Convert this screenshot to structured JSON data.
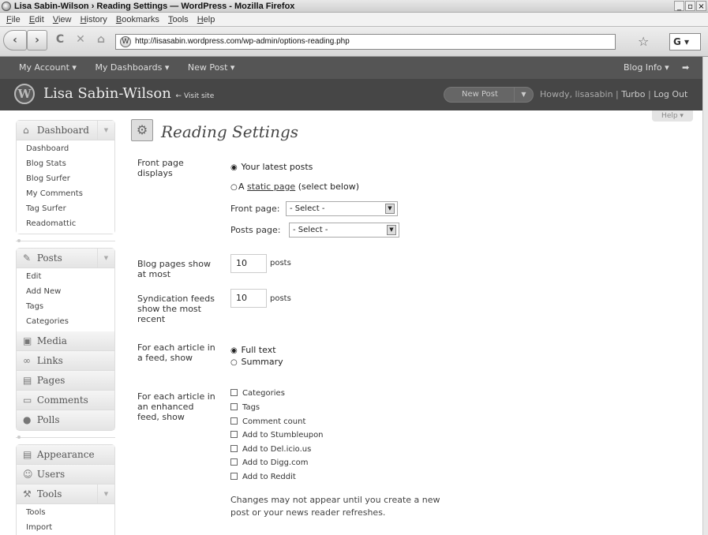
{
  "window": {
    "title": "Lisa Sabin-Wilson › Reading Settings — WordPress - Mozilla Firefox",
    "controls": [
      "_",
      "▫",
      "×"
    ]
  },
  "menubar": [
    "File",
    "Edit",
    "View",
    "History",
    "Bookmarks",
    "Tools",
    "Help"
  ],
  "nav": {
    "back": "‹",
    "forward": "›",
    "reload": "C",
    "stop": "✕",
    "home": "⌂",
    "url": "http://lisasabin.wordpress.com/wp-admin/options-reading.php",
    "favicon": "W",
    "search_engine": "G"
  },
  "adminbar": {
    "left": [
      "My Account ▾",
      "My Dashboards ▾",
      "New Post ▾"
    ],
    "right": "Blog Info ▾",
    "arrow": "➡"
  },
  "header": {
    "site_title": "Lisa Sabin-Wilson",
    "visit_site": "← Visit site",
    "new_post": "New Post",
    "howdy": "Howdy, lisasabin",
    "turbo": "Turbo",
    "logout": "Log Out"
  },
  "help": "Help ▾",
  "sidebar": {
    "dashboard": {
      "label": "Dashboard",
      "items": [
        "Dashboard",
        "Blog Stats",
        "Blog Surfer",
        "My Comments",
        "Tag Surfer",
        "Readomattic"
      ]
    },
    "posts": {
      "label": "Posts",
      "items": [
        "Edit",
        "Add New",
        "Tags",
        "Categories"
      ]
    },
    "menus": [
      "Media",
      "Links",
      "Pages",
      "Comments",
      "Polls"
    ],
    "menus2": [
      "Appearance",
      "Users"
    ],
    "tools": {
      "label": "Tools",
      "items": [
        "Tools",
        "Import"
      ]
    }
  },
  "page": {
    "title": "Reading Settings",
    "front_page_displays": {
      "label": "Front page displays",
      "opt_latest": "Your latest posts",
      "opt_static_pre": "A",
      "opt_static_link": "static page",
      "opt_static_post": "(select below)",
      "front_label": "Front page:",
      "front_value": "- Select -",
      "posts_label": "Posts page:",
      "posts_value": "- Select -"
    },
    "blog_pages": {
      "label": "Blog pages show at most",
      "value": "10",
      "unit": "posts"
    },
    "syndication": {
      "label": "Syndication feeds show the most recent",
      "value": "10",
      "unit": "posts"
    },
    "feed_article": {
      "label": "For each article in a feed, show",
      "opt_full": "Full text",
      "opt_summary": "Summary"
    },
    "enhanced": {
      "label": "For each article in an enhanced feed, show",
      "options": [
        "Categories",
        "Tags",
        "Comment count",
        "Add to Stumbleupon",
        "Add to Del.icio.us",
        "Add to Digg.com",
        "Add to Reddit"
      ]
    },
    "note": "Changes may not appear until you create a new post or your news reader refreshes."
  }
}
